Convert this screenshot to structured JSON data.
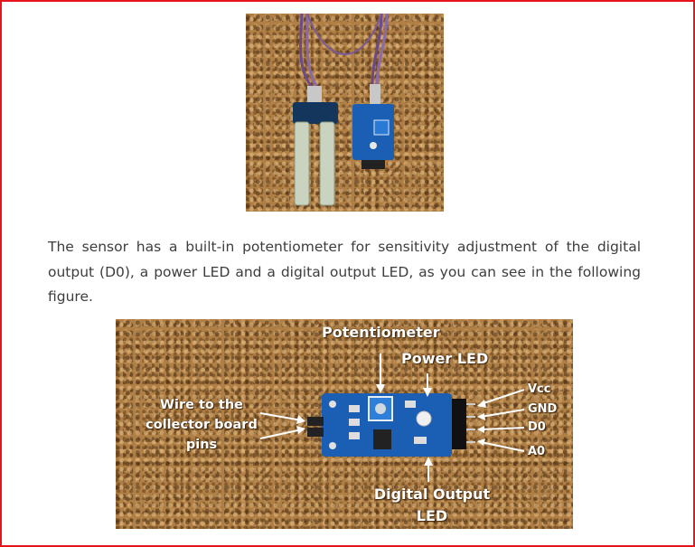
{
  "paragraph": "The sensor has a built-in potentiometer for sensitivity adjustment of the digital output (D0), a power LED and a digital output LED, as you can see in the following figure.",
  "figure2": {
    "labels": {
      "potentiometer": "Potentiometer",
      "power_led": "Power LED",
      "wire_line1": "Wire to the",
      "wire_line2": "collector board",
      "wire_line3": "pins",
      "vcc": "Vcc",
      "gnd": "GND",
      "d0": "D0",
      "a0": "A0",
      "digital_output_line1": "Digital Output",
      "digital_output_line2": "LED"
    }
  },
  "colors": {
    "border": "#e8141b",
    "cork": "#b07f45",
    "pcb": "#1a5fb4",
    "text": "#3d3d3d"
  }
}
